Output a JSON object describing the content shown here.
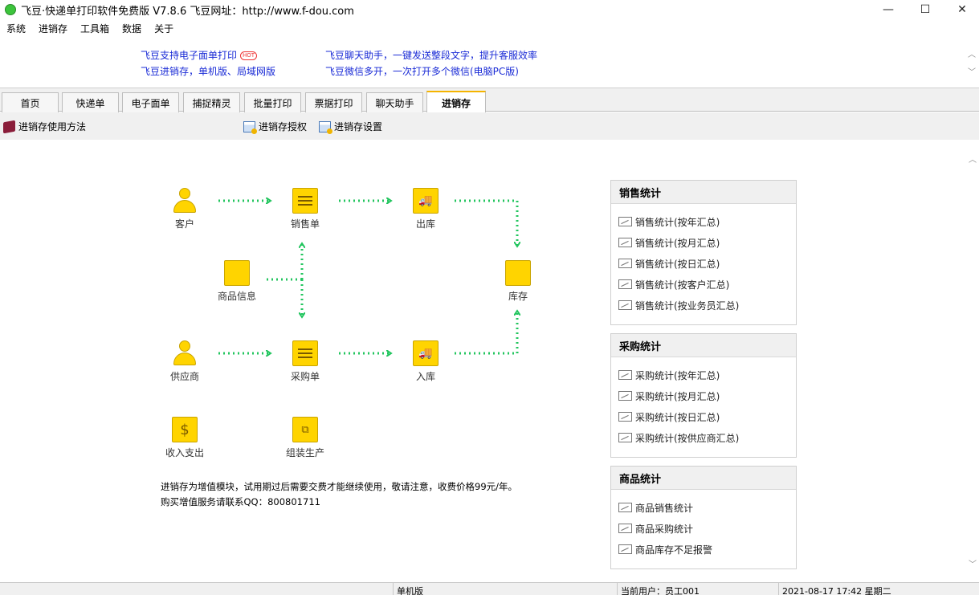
{
  "window": {
    "title": "飞豆·快递单打印软件免费版 V7.8.6   飞豆网址：http://www.f-dou.com",
    "minimize": "—",
    "maximize": "☐",
    "close": "✕"
  },
  "menu": [
    "系统",
    "进销存",
    "工具箱",
    "数据",
    "关于"
  ],
  "ads": {
    "left": [
      "飞豆支持电子面单打印",
      "飞豆进销存，单机版、局域网版"
    ],
    "hot_badge": "HOT",
    "right": [
      "飞豆聊天助手，一键发送整段文字，提升客服效率",
      "飞豆微信多开，一次打开多个微信(电脑PC版)"
    ]
  },
  "tabs": [
    "首页",
    "快递单",
    "电子面单",
    "捕捉精灵",
    "批量打印",
    "票据打印",
    "聊天助手",
    "进销存"
  ],
  "active_tab": "进销存",
  "toolbar": {
    "guide": "进销存使用方法",
    "license": "进销存授权",
    "settings": "进销存设置"
  },
  "flow": {
    "customer": "客户",
    "sales_order": "销售单",
    "outbound": "出库",
    "product_info": "商品信息",
    "inventory": "库存",
    "supplier": "供应商",
    "purchase_order": "采购单",
    "inbound": "入库",
    "income_expense": "收入支出",
    "assembly": "组装生产",
    "dollar_glyph": "$"
  },
  "notice": {
    "line1": "进销存为增值模块，试用期过后需要交费才能继续使用，敬请注意，收费价格99元/年。",
    "line2": "购买增值服务请联系QQ：800801711"
  },
  "stats": {
    "sales": {
      "title": "销售统计",
      "items": [
        "销售统计(按年汇总)",
        "销售统计(按月汇总)",
        "销售统计(按日汇总)",
        "销售统计(按客户汇总)",
        "销售统计(按业务员汇总)"
      ]
    },
    "purchase": {
      "title": "采购统计",
      "items": [
        "采购统计(按年汇总)",
        "采购统计(按月汇总)",
        "采购统计(按日汇总)",
        "采购统计(按供应商汇总)"
      ]
    },
    "product": {
      "title": "商品统计",
      "items": [
        "商品销售统计",
        "商品采购统计",
        "商品库存不足报警"
      ]
    }
  },
  "statusbar": {
    "edition": "单机版",
    "user": "当前用户：员工001",
    "datetime": "2021-08-17 17:42 星期二"
  },
  "colors": {
    "accent_yellow": "#ffd400",
    "flow_arrow": "#22c55e",
    "ad_link": "#1a2bd6"
  }
}
